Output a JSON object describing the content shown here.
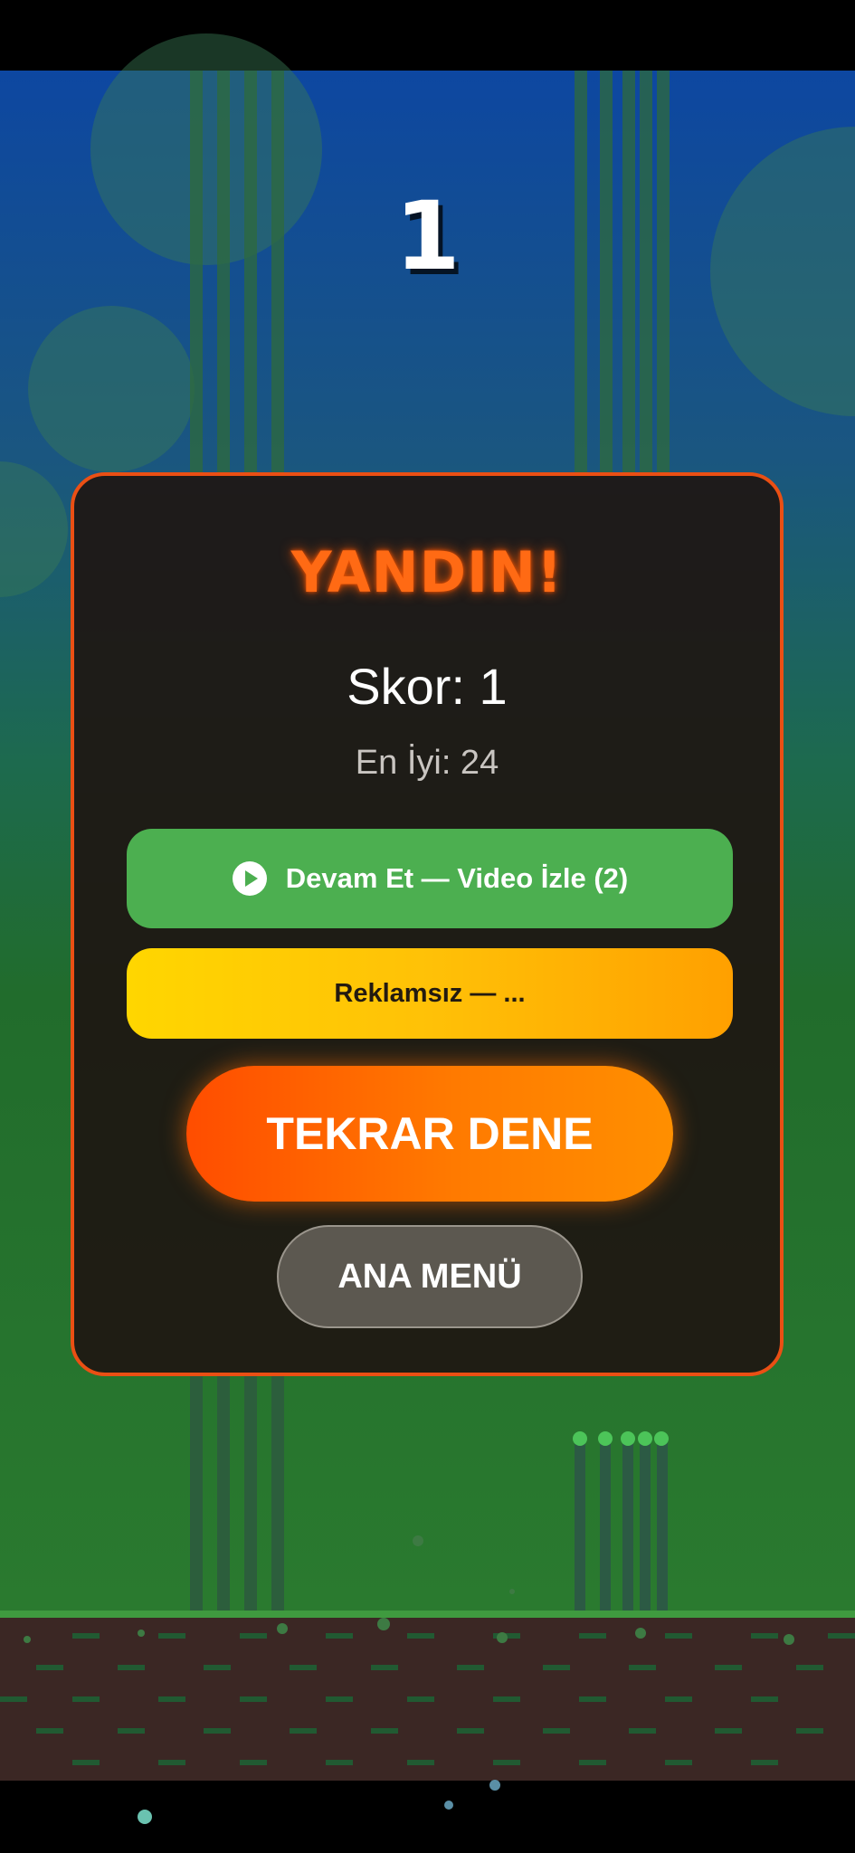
{
  "hud": {
    "score": "1"
  },
  "dialog": {
    "title": "YANDIN!",
    "score_text": "Skor: 1",
    "best_text": "En İyi: 24",
    "continue_label": "Devam Et — Video İzle (2)",
    "noads_label": "Reklamsız — ...",
    "retry_label": "TEKRAR DENE",
    "menu_label": "ANA MENÜ"
  },
  "icons": {
    "continue": "play-circle-icon"
  },
  "colors": {
    "panel_border": "#ea4f14",
    "title": "#ff6a14",
    "continue_button": "#4caf50",
    "noads_button": "#ffc107",
    "retry_button": "#ff6a00",
    "menu_button": "#5c5850"
  }
}
